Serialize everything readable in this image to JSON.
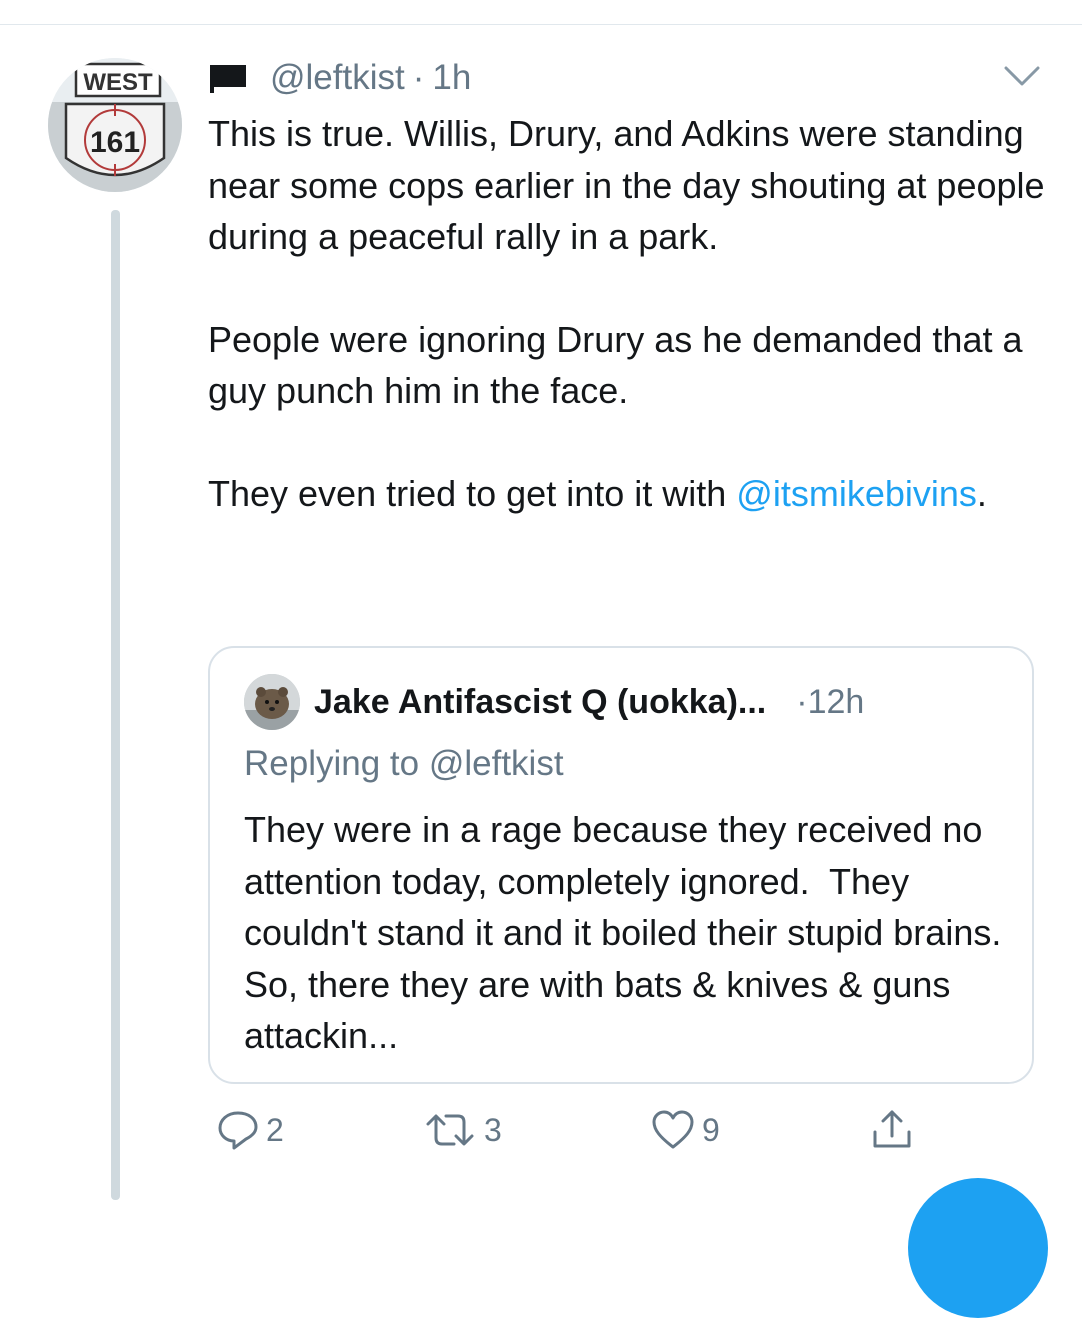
{
  "tweet": {
    "handle": "@leftkist",
    "separator": "·",
    "time": "1h",
    "paragraphs": [
      "This is true. Willis, Drury, and Adkins were standing near some cops earlier in the day shouting at people during a peaceful rally in a park.",
      "People were ignoring Drury as he demanded that a guy punch him in the face."
    ],
    "last_paragraph_prefix": "They even tried to get into it with ",
    "last_paragraph_mention": "@itsmikebivins",
    "last_paragraph_suffix": ".",
    "avatar_sign_top": "WEST",
    "avatar_sign_number": "161"
  },
  "quote": {
    "name": "Jake Antifascist Q (uokka)...",
    "separator": "·",
    "time": "12h",
    "replying_to": "Replying to @leftkist",
    "text": "They were in a rage because they received no attention today, completely ignored.  They couldn't stand it and it boiled their stupid brains. So, there they are with bats & knives & guns attackin..."
  },
  "actions": {
    "reply_count": "2",
    "retweet_count": "3",
    "like_count": "9"
  },
  "icons": {
    "flag": "black-flag-icon",
    "menu": "chevron-down-icon",
    "reply": "reply-icon",
    "retweet": "retweet-icon",
    "like": "heart-icon",
    "share": "share-icon"
  },
  "colors": {
    "link": "#1da1f2",
    "secondary_text": "#657786",
    "primary_text": "#14171a",
    "border": "#d9e1e8"
  }
}
